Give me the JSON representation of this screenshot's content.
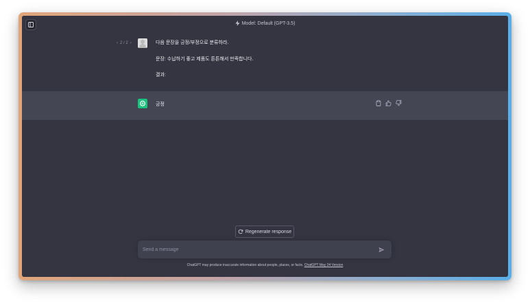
{
  "header": {
    "model_label": "Model: Default (GPT-3.5)"
  },
  "user_message": {
    "pager": "2 / 2",
    "lines": [
      "다음 문장을 긍정/부정으로 분류하라.",
      "문장: 수납하기 좋고 제품도 튼튼해서 만족합니다.",
      "결과:"
    ]
  },
  "assistant_message": {
    "text": "긍정"
  },
  "regenerate_label": "Regenerate response",
  "input": {
    "placeholder": "Send a message",
    "value": ""
  },
  "footer": {
    "text": "ChatGPT may produce inaccurate information about people, places, or facts.",
    "link": "ChatGPT May 24 Version"
  },
  "colors": {
    "background": "#343541",
    "assistant_row": "#444654",
    "gpt_green": "#19c37d",
    "input_bg": "#40414f"
  },
  "icons": [
    "sidebar-toggle-icon",
    "bolt-icon",
    "chevron-left-icon",
    "chevron-right-icon",
    "user-avatar-icon",
    "openai-logo-icon",
    "copy-icon",
    "thumbs-up-icon",
    "thumbs-down-icon",
    "refresh-icon",
    "send-icon"
  ]
}
